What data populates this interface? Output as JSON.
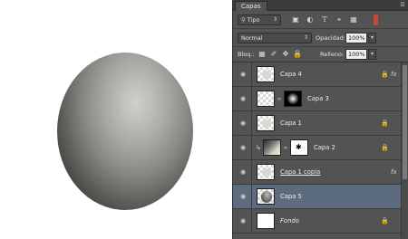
{
  "panel": {
    "tab_label": "Capas",
    "menu_icon": "panel-menu-icon",
    "filter": {
      "label": "Tipo",
      "icon": "search-icon"
    },
    "filter_icons": [
      "pixel-filter-icon",
      "adjustment-filter-icon",
      "type-filter-icon",
      "shape-filter-icon",
      "smart-object-filter-icon"
    ],
    "blend_mode": "Normal",
    "opacity": {
      "label": "Opacidad:",
      "value": "100%"
    },
    "lock": {
      "label": "Bloq.:",
      "icons": [
        "lock-transparent-icon",
        "lock-image-icon",
        "lock-position-icon",
        "lock-all-icon"
      ]
    },
    "fill": {
      "label": "Relleno:",
      "value": "100%"
    }
  },
  "layers": [
    {
      "name": "Capa 4",
      "thumb": "checker-blob",
      "fx": true,
      "locked": true,
      "selected": false
    },
    {
      "name": "Capa 3",
      "thumb": "checker-with-mask-glow",
      "fx": false,
      "locked": false,
      "selected": false
    },
    {
      "name": "Capa 1",
      "thumb": "checker-blob",
      "fx": false,
      "locked": true,
      "selected": false
    },
    {
      "name": "Capa 2",
      "thumb": "gradient-with-mask",
      "fx": false,
      "locked": true,
      "selected": false
    },
    {
      "name": "Capa 1 copia",
      "thumb": "checker-blob",
      "fx": true,
      "locked": false,
      "selected": false
    },
    {
      "name": "Capa 5",
      "thumb": "checker-sphere",
      "fx": false,
      "locked": false,
      "selected": true
    },
    {
      "name": "Fondo",
      "thumb": "white",
      "fx": false,
      "locked": true,
      "selected": false
    }
  ],
  "colors": {
    "panel_bg": "#535353",
    "selected_row": "#5c6b7e",
    "filter_toggle": "#c9463a"
  }
}
